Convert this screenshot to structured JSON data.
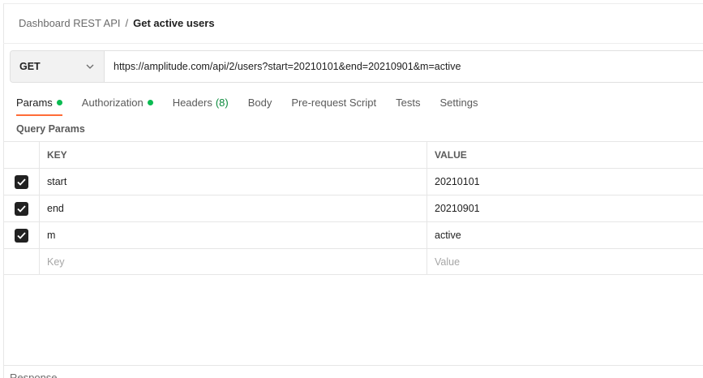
{
  "breadcrumb": {
    "parent": "Dashboard REST API",
    "separator": "/",
    "current": "Get active users"
  },
  "request": {
    "method": "GET",
    "url": "https://amplitude.com/api/2/users?start=20210101&end=20210901&m=active"
  },
  "tabs": [
    {
      "label": "Params",
      "active": true,
      "dot": true
    },
    {
      "label": "Authorization",
      "dot": true
    },
    {
      "label": "Headers",
      "count": "(8)"
    },
    {
      "label": "Body"
    },
    {
      "label": "Pre-request Script"
    },
    {
      "label": "Tests"
    },
    {
      "label": "Settings"
    }
  ],
  "query_params": {
    "title": "Query Params",
    "headers": {
      "key": "KEY",
      "value": "VALUE"
    },
    "rows": [
      {
        "checked": true,
        "key": "start",
        "value": "20210101"
      },
      {
        "checked": true,
        "key": "end",
        "value": "20210901"
      },
      {
        "checked": true,
        "key": "m",
        "value": "active"
      }
    ],
    "placeholder": {
      "key": "Key",
      "value": "Value"
    }
  },
  "response": {
    "label": "Response"
  },
  "colors": {
    "accent": "#ff6c37",
    "status_dot": "#0cbb52",
    "headers_count": "#0c8a3d"
  }
}
